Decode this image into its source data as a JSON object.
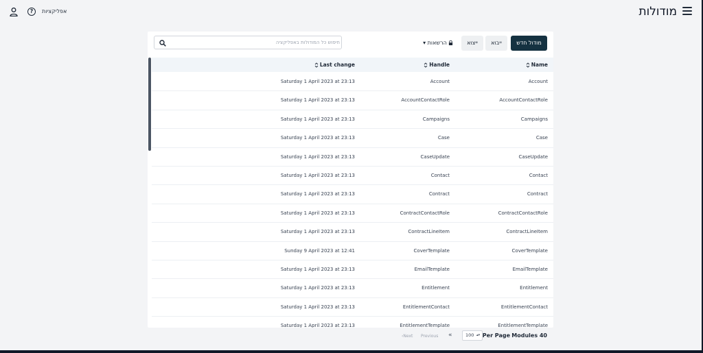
{
  "header": {
    "title": "מודולות",
    "apps_label": "אפליקציות",
    "menu_icon": "hamburger-menu-icon",
    "help_icon": "question-circle-icon",
    "user_icon": "user-icon",
    "help_glyph": "?"
  },
  "toolbar": {
    "new_module_label": "מודול חדש",
    "import_label": "ייבוא",
    "export_label": "ייצוא",
    "permissions_label": "הרשאות ▾",
    "search_placeholder": "חיפוש כל המודולות באפליקציה",
    "primary_color": "#153241"
  },
  "table": {
    "columns": {
      "name": "Name",
      "handle": "Handle",
      "last_change": "Last change"
    },
    "rows": [
      {
        "name": "Account",
        "handle": "Account",
        "last_change": "Saturday 1 April 2023 at 23:13"
      },
      {
        "name": "AccountContactRole",
        "handle": "AccountContactRole",
        "last_change": "Saturday 1 April 2023 at 23:13"
      },
      {
        "name": "Campaigns",
        "handle": "Campaigns",
        "last_change": "Saturday 1 April 2023 at 23:13"
      },
      {
        "name": "Case",
        "handle": "Case",
        "last_change": "Saturday 1 April 2023 at 23:13"
      },
      {
        "name": "CaseUpdate",
        "handle": "CaseUpdate",
        "last_change": "Saturday 1 April 2023 at 23:13"
      },
      {
        "name": "Contact",
        "handle": "Contact",
        "last_change": "Saturday 1 April 2023 at 23:13"
      },
      {
        "name": "Contract",
        "handle": "Contract",
        "last_change": "Saturday 1 April 2023 at 23:13"
      },
      {
        "name": "ContractContactRole",
        "handle": "ContractContactRole",
        "last_change": "Saturday 1 April 2023 at 23:13"
      },
      {
        "name": "ContractLineItem",
        "handle": "ContractLineItem",
        "last_change": "Saturday 1 April 2023 at 23:13"
      },
      {
        "name": "CoverTemplate",
        "handle": "CoverTemplate",
        "last_change": "Sunday 9 April 2023 at 12:41"
      },
      {
        "name": "EmailTemplate",
        "handle": "EmailTemplate",
        "last_change": "Saturday 1 April 2023 at 23:13"
      },
      {
        "name": "Entitlement",
        "handle": "Entitlement",
        "last_change": "Saturday 1 April 2023 at 23:13"
      },
      {
        "name": "EntitlementContact",
        "handle": "EntitlementContact",
        "last_change": "Saturday 1 April 2023 at 23:13"
      },
      {
        "name": "EntitlementTemplate",
        "handle": "EntitlementTemplate",
        "last_change": "Saturday 1 April 2023 at 23:13"
      }
    ]
  },
  "footer": {
    "count_label": "Modules 40",
    "per_page_label": "Per Page",
    "per_page_value": "100",
    "first_label": "«",
    "previous_label": "Previous",
    "next_label": "‹Next",
    "caret_glyph": "▴▾"
  }
}
